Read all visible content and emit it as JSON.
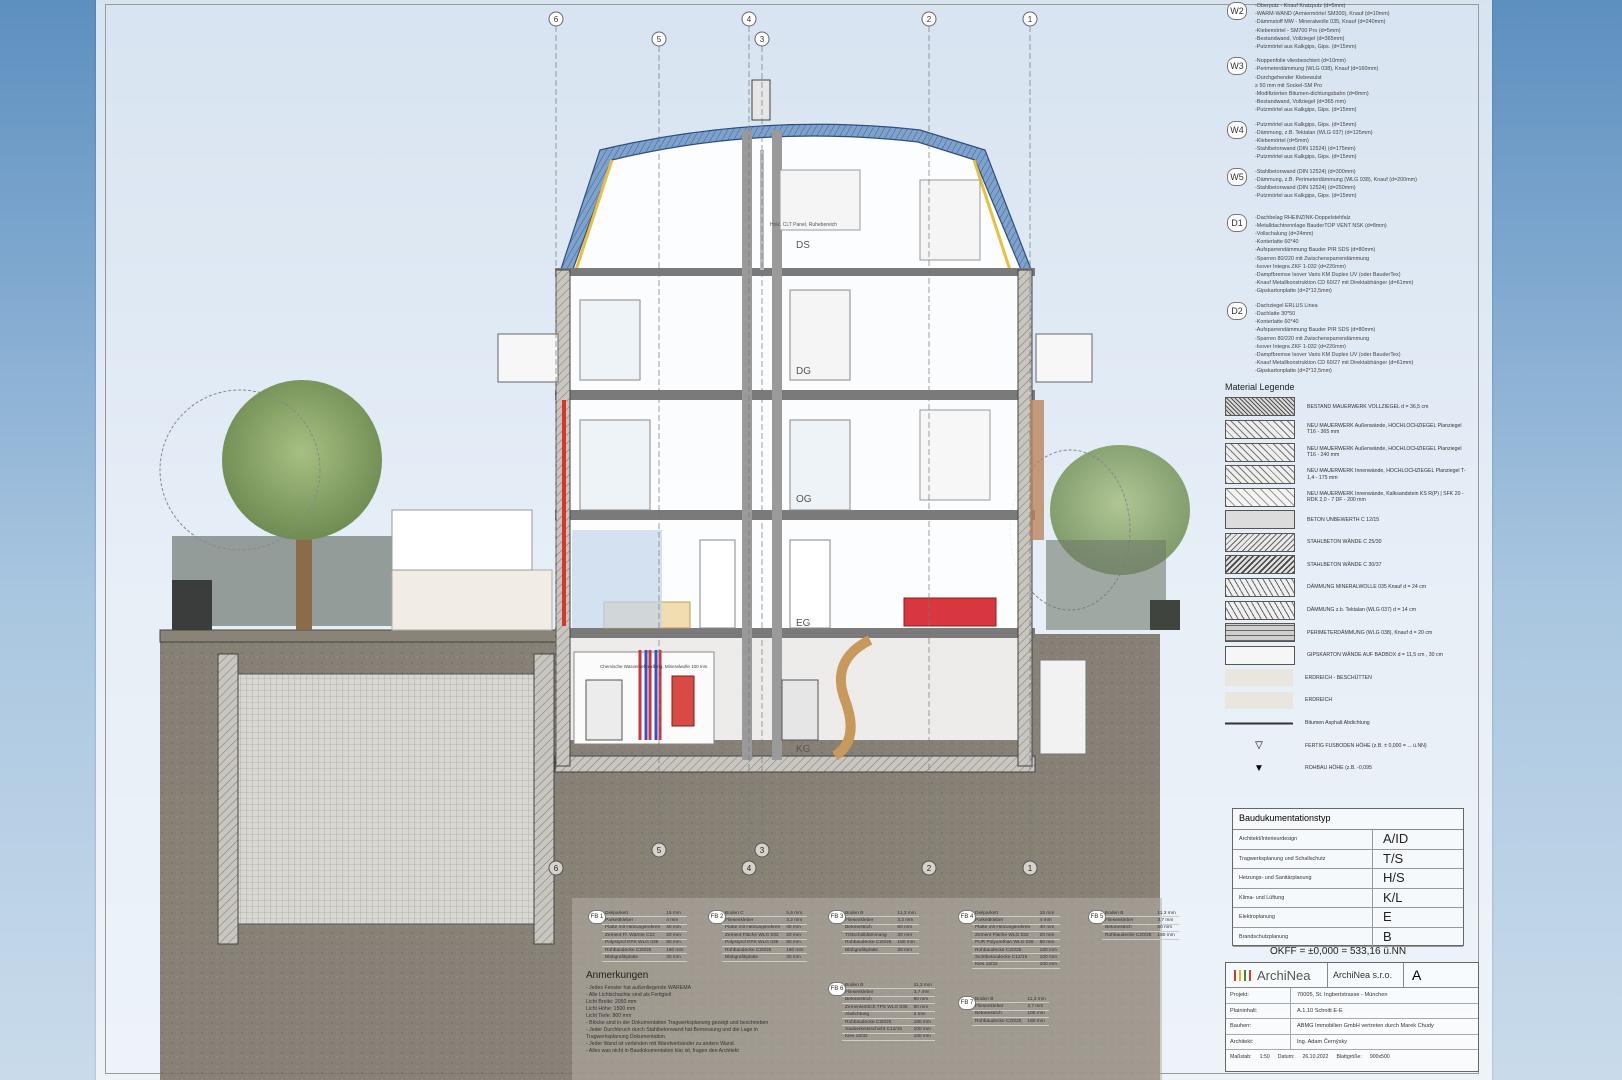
{
  "axes": {
    "top": [
      "6",
      "5",
      "4",
      "3",
      "2",
      "1"
    ],
    "bottom": [
      "6",
      "5",
      "4",
      "3",
      "2",
      "1"
    ]
  },
  "floors": {
    "ds": "DS",
    "dg": "DG",
    "og": "OG",
    "eg": "EG",
    "kg": "KG"
  },
  "room_labels": {
    "ds_note": "Holz. CLT Panel, Ruhebereich",
    "kg_tech": "Chemische Wasserbehandlung, Mineralwolle 100 mm"
  },
  "walls": [
    {
      "tag": "W2",
      "lines": [
        "-Oberputz - Knauf Kratzputz  (d=5mm)",
        "-WARM-WAND (Armiermörtel SM300), Knauf (d=10mm)",
        "-Dämmstoff MW - Mineralwolle 035, Knauf (d=240mm)",
        "-Klebemörtel - SM700 Pro (d=5mm)",
        "-Bestandwand, Vollziegel (d=365mm)",
        "-Putzmörtel aus Kalkgips, Gips. (d=15mm)"
      ]
    },
    {
      "tag": "W3",
      "lines": [
        "-Noppenfolie vliesbeschiert  (d=10mm)",
        "-Perimeterdämmung (WLG 038), Knauf (d=160mm)",
        "-Durchgehender Klebewulst",
        "  ≥ 50 mm mit Sockel-SM Pro",
        "-Modifizierten Bitumen-dichtungsbahn (d=8mm)",
        "-Bestandwand, Vollziegel (d=365 mm)",
        "-Putzmörtel aus Kalkgips, Gips. (d=15mm)"
      ]
    },
    {
      "tag": "W4",
      "lines": [
        "-Putzmörtel aus Kalkgips, Gips. (d=15mm)",
        "-Dämmung, z.B. Tektalan (WLG 037) (d=125mm)",
        "-Klebemörtel (d=5mm)",
        "-Stahlbetonwand (DIN 12524) (d=175mm)",
        "-Putzmörtel aus Kalkgips, Gips. (d=15mm)"
      ]
    },
    {
      "tag": "W5",
      "lines": [
        "-Stahlbetonwand (DIN 12524) (d=300mm)",
        "-Dämmung, z.B. Perimeterdämmung (WLG 038), Knauf (d=200mm)",
        "-Stahlbetonwand (DIN 12524) (d=250mm)",
        "-Putzmörtel aus Kalkgips, Gips. (d=15mm)"
      ]
    },
    {
      "tag": "D1",
      "lines": [
        "-Dachbelag RHEINZINK-Doppelstehfalz",
        "-Metalldachtrennlage BauderTOP VENT NSK (d=8mm)",
        "-Vollschalung (d=24mm)",
        "-Konterlatte 60*40",
        "-Aufsparrendämmung Bauder PIR SDS (d=80mm)",
        "-Sparren 80/220 mit Zwischensparrendämmung",
        "-Isover Integra ZKF 1-032 (d=220mm)",
        "-Dampfbremse Isover Vario KM Duplex UV (oder BauderTex)",
        "-Knauf Metallkonstruktion CD 60/27 mit Direktabhänger (d=61mm)",
        "-Gipskartonplatte (d=2*12,5mm)"
      ]
    },
    {
      "tag": "D2",
      "lines": [
        "-Dachziegel ERLUS Linea",
        "-Dachlatte 30*50",
        "-Konterlatte 60*40",
        "-Aufsparrendämmung Bauder PIR SDS (d=80mm)",
        "-Sparren 80/220 mit Zwischensparrendämmung",
        "-Isover Integra ZKF 1-032 (d=220mm)",
        "-Dampfbremse Isover Vario KM Duplex UV (oder BauderTex)",
        "-Knauf Metallkonstruktion CD 60/27 mit Direktabhänger (d=61mm)",
        "-Gipskartonplatte (d=2*12,5mm)"
      ]
    }
  ],
  "legend": {
    "title": "Material Legende",
    "items": [
      {
        "label": "BESTAND MAUERWERK VOLLZIEGEL d = 36,5 cm",
        "pattern": "hatch-dense"
      },
      {
        "label": "NEU MAUERWERK Außenwände, HOCHLOCHZIEGEL Planziegel T16 - 365 mm",
        "pattern": "hatch-cross"
      },
      {
        "label": "NEU MAUERWERK Außenwände, HOCHLOCHZIEGEL Planziegel T16 - 240 mm",
        "pattern": "hatch-cross"
      },
      {
        "label": "NEU MAUERWERK Innenwände, HOCHLOCHZIEGEL Planziegel T-1,4 - 175 mm",
        "pattern": "hatch-cross"
      },
      {
        "label": "NEU MAUERWERK Innenwände, Kalksandstein KS R(P) | SFK 20 - RDK 2,0 - 7 DF - 200 mm",
        "pattern": "hatch-light"
      },
      {
        "label": "BETON UNBEWERTH C 12/15",
        "pattern": "dots"
      },
      {
        "label": "STAHLBETON WÄNDE C 25/30",
        "pattern": "hatch-diag"
      },
      {
        "label": "STAHLBETON WÄNDE C 30/37",
        "pattern": "hatch-diag2"
      },
      {
        "label": "DÄMMUNG MINERALWOLLE 035 Knauf d = 24 cm",
        "pattern": "zigzag"
      },
      {
        "label": "DÄMMUNG z.b. Tektalan (WLG 037) d = 14 cm",
        "pattern": "zigzag"
      },
      {
        "label": "PERIMETERDÄMMUNG (WLG 038), Knauf d = 20 cm",
        "pattern": "grid"
      },
      {
        "label": "GIPSKARTON WÄNDE AUF BADBOX d = 11,5 cm , 30 cm",
        "pattern": "plain"
      },
      {
        "label": "ERDREICH - BESCHÜTTEN",
        "pattern": "soil"
      },
      {
        "label": "ERDREICH",
        "pattern": "soil2"
      },
      {
        "label": "Bitumen Asphalt Abdichtung",
        "pattern": "dash"
      },
      {
        "label": "FERTIG FUSBODEN HÖHE (z.B. ± 0,000 = ... ü.NN)",
        "pattern": "tri-open"
      },
      {
        "label": "ROHBAU HÖHE (z.B. -0,095",
        "pattern": "tri-fill"
      }
    ]
  },
  "docs": {
    "title": "Baudukumentationstyp",
    "rows": [
      {
        "label": "Architekt/Interieurdesign",
        "code": "A/ID"
      },
      {
        "label": "Tragwerksplanung und Schallschutz",
        "code": "T/S"
      },
      {
        "label": "Heizungs- und Sanitärplanung",
        "code": "H/S"
      },
      {
        "label": "Klima- und Lüftung",
        "code": "K/L"
      },
      {
        "label": "Elektroplanung",
        "code": "E"
      },
      {
        "label": "Brandschutzplanung",
        "code": "B"
      }
    ]
  },
  "okff": "OKFF = ±0,000 = 533,16 ü.NN",
  "titleblock": {
    "logo": "ArchiNea",
    "company": "ArchiNea s.r.o.",
    "revision": "A",
    "logo_colors": [
      "#d23b2b",
      "#e7b317",
      "#3b8a3a"
    ],
    "rows": [
      {
        "k": "Projekt:",
        "v": "70005, St. Ingbertstrasse - München"
      },
      {
        "k": "Plaininhalt:",
        "v": "A.1.10 Schnitt E-E"
      },
      {
        "k": "Bauherr:",
        "v": "ABMG Immobilien GmbH vertreten durch Marek Chudy"
      },
      {
        "k": "Architekt:",
        "v": "Ing. Adam Černýsky"
      }
    ],
    "foot": {
      "scale_label": "Maßstab:",
      "scale": "1:50",
      "date_label": "Datum:",
      "date": "26.10.2022",
      "size_label": "Blattgröße:",
      "size": "900x500"
    }
  },
  "floor_buildups": [
    {
      "tag": "FB 1",
      "rows": [
        [
          "Dielparkett",
          "15 mm"
        ],
        [
          "Parkettkleber",
          "4 mm"
        ],
        [
          "Platte mit Heizungsrohren",
          "40 mm"
        ],
        [
          "Zement Fl. Wärme C12",
          "20 mm"
        ],
        [
          "Polystyrol EPS WLG 035",
          "80 mm"
        ],
        [
          "Rohbaudecke C20/25",
          "180 mm"
        ],
        [
          "Blähgrafikplatte",
          "30 mm"
        ]
      ]
    },
    {
      "tag": "FB 2",
      "rows": [
        [
          "Boden C",
          "5,6 mm"
        ],
        [
          "Fliesenkleber",
          "3,2 mm"
        ],
        [
          "Platte mit Heizungsrohren",
          "40 mm"
        ],
        [
          "Zement Fläche WLG 032",
          "20 mm"
        ],
        [
          "Polystyrol EPS WLG 035",
          "80 mm"
        ],
        [
          "Rohbaudecke C20/25",
          "180 mm"
        ],
        [
          "Blähgrafikplatte",
          "30 mm"
        ]
      ]
    },
    {
      "tag": "FB 3",
      "rows": [
        [
          "Boden B",
          "11,3 mm"
        ],
        [
          "Fliesenkleber",
          "3,2 mm"
        ],
        [
          "Betonestrich",
          "60 mm"
        ],
        [
          "Trittschalldämmung",
          "30 mm"
        ],
        [
          "Rohbaudecke C20/25",
          "180 mm"
        ],
        [
          "Blähgrafikplatte",
          "30 mm"
        ]
      ]
    },
    {
      "tag": "FB 4",
      "rows": [
        [
          "Dielparkett",
          "15 mm"
        ],
        [
          "Parkettkleber",
          "4 mm"
        ],
        [
          "Platte mit Heizungsrohren",
          "40 mm"
        ],
        [
          "Zement Fläche WLG 032",
          "20 mm"
        ],
        [
          "PUR Polyurethan WLG 026",
          "80 mm"
        ],
        [
          "Rohbaudecke C20/25",
          "180 mm"
        ],
        [
          "Sichtbetondecke C12/15",
          "100 mm"
        ],
        [
          "Kies 16/32",
          "100 mm"
        ]
      ]
    },
    {
      "tag": "FB 5",
      "rows": [
        [
          "Boden B",
          "11,3 mm"
        ],
        [
          "Fliesenkleber",
          "3,7 mm"
        ],
        [
          "Betonestrich",
          "60 mm"
        ],
        [
          "Rohbaudecke C20/25",
          "180 mm"
        ]
      ]
    },
    {
      "tag": "FB 6",
      "rows": [
        [
          "Boden B",
          "11,3 mm"
        ],
        [
          "Fliesenkleber",
          "3,7 mm"
        ],
        [
          "Betonestrich",
          "60 mm"
        ],
        [
          "Zementestrich TPS WLG 035",
          "60 mm"
        ],
        [
          "Abdichtung",
          "2 mm"
        ],
        [
          "Rohbaudecke C20/25",
          "180 mm"
        ],
        [
          "Sauberkeitsschicht C12/15",
          "100 mm"
        ],
        [
          "Kies 16/32",
          "100 mm"
        ]
      ]
    },
    {
      "tag": "FB 7",
      "rows": [
        [
          "Boden B",
          "11,3 mm"
        ],
        [
          "Fliesenkleber",
          "3,7 mm"
        ],
        [
          "Betonestrich",
          "100 mm"
        ],
        [
          "Rohbaudecke C20/25",
          "180 mm"
        ]
      ]
    }
  ],
  "remarks": {
    "title": "Anmerkungen",
    "lines": [
      "- Jedes Fenster hat außenliegende WAREMA",
      "- Alle Lichtschachte sind als Fertigteil",
      "  Licht Breite: 2050 mm",
      "  Licht Höhe: 1500 mm",
      "  Licht Tiefe: 800 mm",
      "- Blöcke sind in der Dokumentation Tragwerksplanung gezeigt und beschrieben",
      "- Jeder Durchbruch durch Stahlbetonwand hat Bemessung und die Lage in",
      "  Tragwerksplanung Dokumentation.",
      "- Jeder Wand ist verbinden mit Wandverbänder zu andere Wand.",
      "- Alles was nicht in Baudokumentation klar ist, fragen den Architekt"
    ]
  }
}
